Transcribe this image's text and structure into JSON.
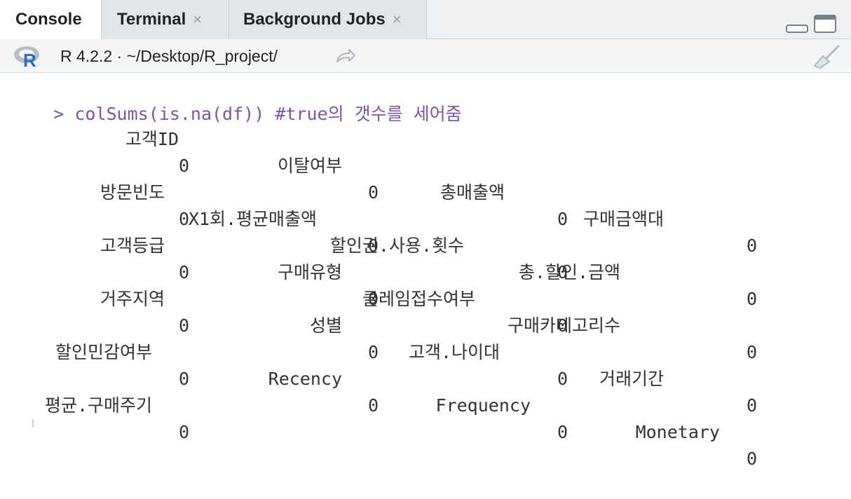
{
  "tabs": [
    {
      "label": "Console",
      "closable": false
    },
    {
      "label": "Terminal",
      "closable": true
    },
    {
      "label": "Background Jobs",
      "closable": true
    }
  ],
  "close_glyph": "×",
  "toolbar": {
    "version_text": "R 4.2.2 · ~/Desktop/R_project/"
  },
  "console": {
    "prompt": ">",
    "command": "colSums(is.na(df)) #true의 갯수를 세어줌",
    "rows": [
      {
        "headers": [
          "고객ID",
          "이탈여부",
          "총매출액",
          "구매금액대"
        ],
        "values": [
          "0",
          "0",
          "0",
          "0"
        ]
      },
      {
        "headers": [
          "방문빈도",
          "X1회.평균매출액",
          "할인권.사용.횟수",
          "총.할인.금액"
        ],
        "values": [
          "0",
          "0",
          "0",
          "0"
        ]
      },
      {
        "headers": [
          "고객등급",
          "구매유형",
          "클레임접수여부",
          "구매카테고리수"
        ],
        "values": [
          "0",
          "0",
          "0",
          "0"
        ]
      },
      {
        "headers": [
          "거주지역",
          "성별",
          "고객.나이대",
          "거래기간"
        ],
        "values": [
          "0",
          "0",
          "0",
          "0"
        ]
      },
      {
        "headers": [
          "할인민감여부",
          "Recency",
          "Frequency",
          "Monetary"
        ],
        "values": [
          "0",
          "0",
          "0",
          "0"
        ]
      },
      {
        "headers": [
          "평균.구매주기"
        ],
        "values": [
          "0"
        ]
      }
    ]
  },
  "colors": {
    "prompt": "#7b55a6",
    "text": "#333333",
    "tabbar": "#eef0f2"
  }
}
